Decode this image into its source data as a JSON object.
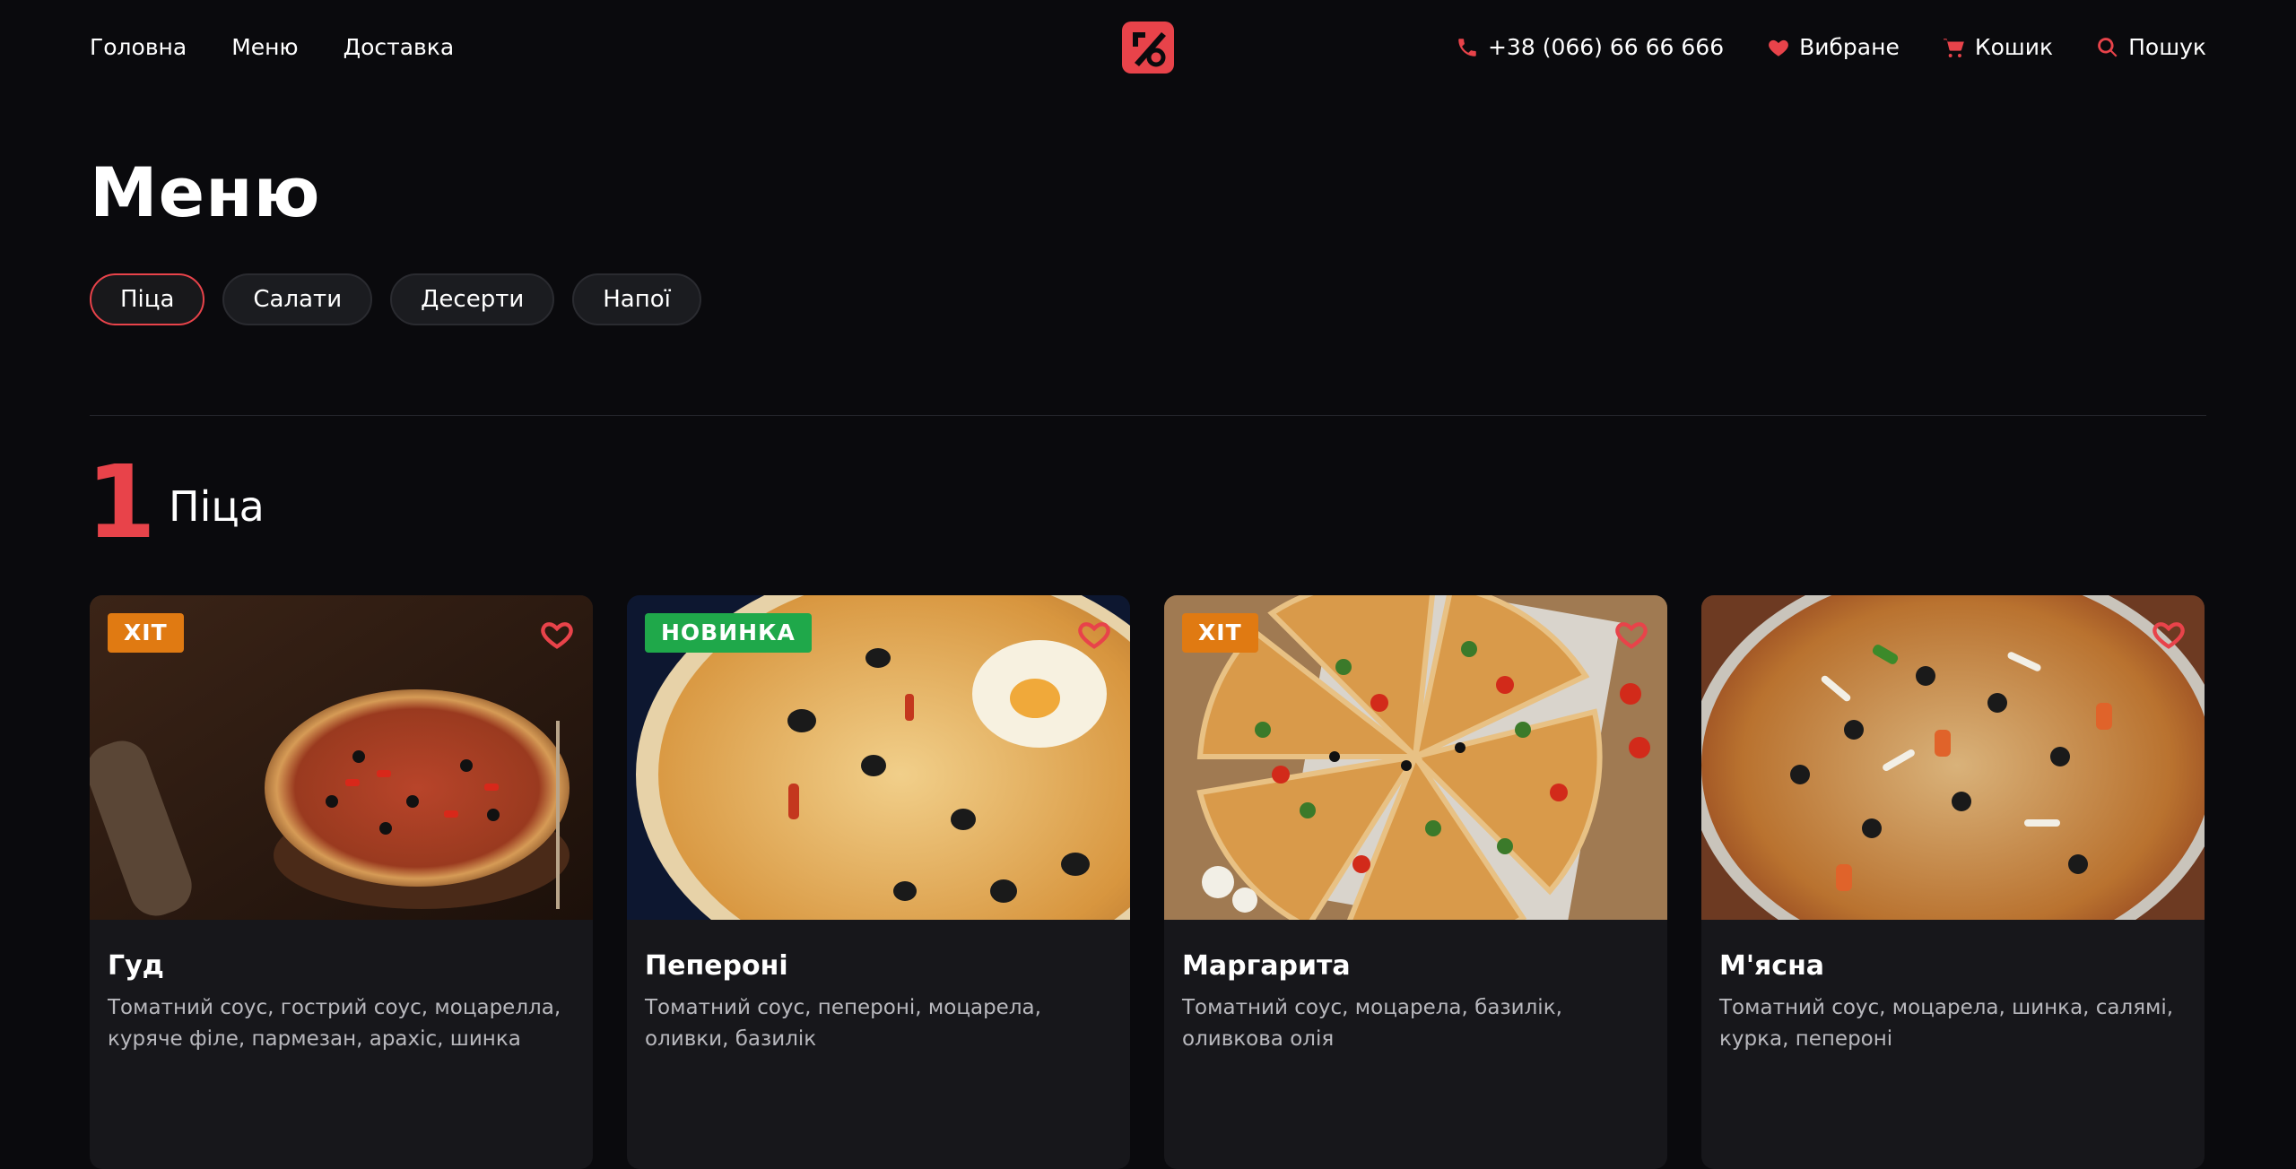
{
  "nav": {
    "home": "Головна",
    "menu": "Меню",
    "delivery": "Доставка",
    "phone": "+38 (066) 66 66 666",
    "favorites": "Вибране",
    "cart": "Кошик",
    "search": "Пошук"
  },
  "page": {
    "title": "Меню"
  },
  "categories": [
    {
      "label": "Піца",
      "active": true
    },
    {
      "label": "Салати",
      "active": false
    },
    {
      "label": "Десерти",
      "active": false
    },
    {
      "label": "Напої",
      "active": false
    }
  ],
  "section": {
    "number": "1",
    "title": "Піца"
  },
  "products": [
    {
      "badge": "ХІТ",
      "title": "Гуд",
      "description": "Томатний соус, гострий соус, моцарелла, куряче філе, пармезан, арахіс, шинка"
    },
    {
      "badge": "НОВИНКА",
      "title": "Пепероні",
      "description": "Томатний соус, пепероні, моцарела, оливки, базилік"
    },
    {
      "badge": "ХІТ",
      "title": "Маргарита",
      "description": "Томатний соус, моцарела, базилік, оливкова олія"
    },
    {
      "badge": "",
      "title": "М'ясна",
      "description": "Томатний соус, моцарела, шинка, салямі, курка, пепероні"
    }
  ],
  "colors": {
    "accent": "#e8434a",
    "hit": "#e07a12",
    "new": "#1fa84a",
    "background": "#0a0a0d"
  }
}
